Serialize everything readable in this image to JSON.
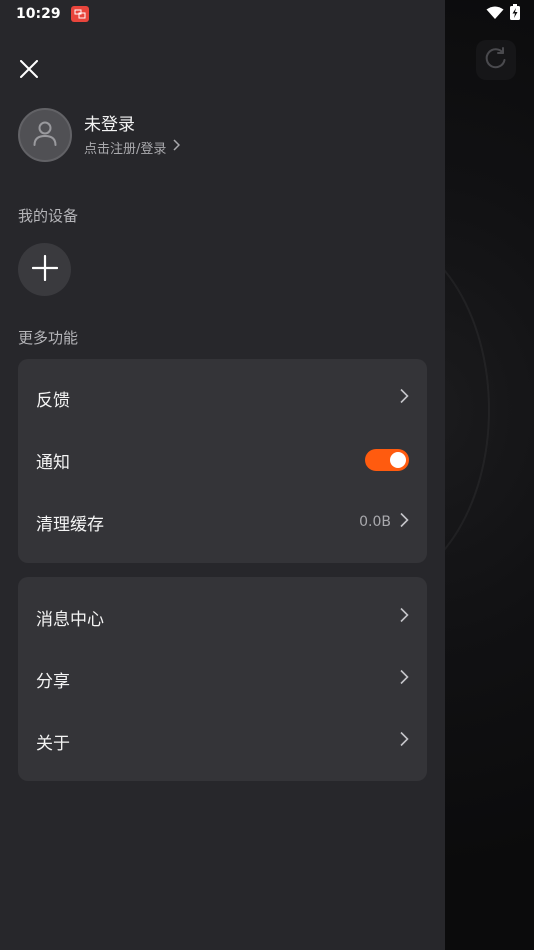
{
  "status_bar": {
    "time": "10:29",
    "icons": [
      "notification-app-icon",
      "wifi-icon",
      "battery-charging-icon"
    ]
  },
  "drawer": {
    "close_icon": "close-icon",
    "profile": {
      "name": "未登录",
      "subtitle": "点击注册/登录",
      "avatar_icon": "user-icon"
    },
    "devices_section": {
      "title": "我的设备",
      "add_icon": "plus-icon"
    },
    "more_section": {
      "title": "更多功能"
    },
    "card1": [
      {
        "label": "反馈"
      },
      {
        "label": "通知",
        "toggle_on": true
      },
      {
        "label": "清理缓存",
        "value": "0.0B"
      }
    ],
    "card2": [
      {
        "label": "消息中心"
      },
      {
        "label": "分享"
      },
      {
        "label": "关于"
      }
    ]
  },
  "colors": {
    "drawer_bg": "#27272b",
    "card_bg": "#343438",
    "accent": "#ff5b0f"
  },
  "background_app": {
    "refresh_icon": "refresh-icon"
  }
}
